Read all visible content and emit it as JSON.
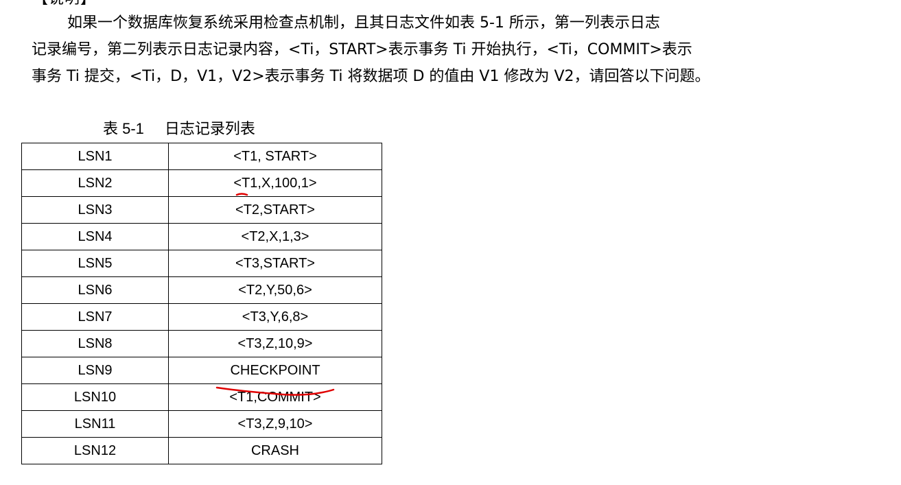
{
  "section_heading": "【说明】",
  "paragraph_lines": [
    "如果一个数据库恢复系统采用检查点机制，且其日志文件如表 5-1 所示，第一列表示日志",
    "记录编号，第二列表示日志记录内容，<Ti，START>表示事务 Ti 开始执行，<Ti，COMMIT>表示",
    "事务 Ti 提交，<Ti，D，V1，V2>表示事务 Ti 将数据项 D 的值由 V1 修改为 V2，请回答以下问题。"
  ],
  "table_caption": {
    "number": "表 5-1",
    "title": "日志记录列表"
  },
  "log_rows": [
    {
      "lsn": "LSN1",
      "record": "<T1, START>"
    },
    {
      "lsn": "LSN2",
      "record": "<T1,X,100,1>"
    },
    {
      "lsn": "LSN3",
      "record": "<T2,START>"
    },
    {
      "lsn": "LSN4",
      "record": "<T2,X,1,3>"
    },
    {
      "lsn": "LSN5",
      "record": "<T3,START>"
    },
    {
      "lsn": "LSN6",
      "record": "<T2,Y,50,6>"
    },
    {
      "lsn": "LSN7",
      "record": "<T3,Y,6,8>"
    },
    {
      "lsn": "LSN8",
      "record": "<T3,Z,10,9>"
    },
    {
      "lsn": "LSN9",
      "record": "CHECKPOINT"
    },
    {
      "lsn": "LSN10",
      "record": "<T1,COMMIT>"
    },
    {
      "lsn": "LSN11",
      "record": "<T3,Z,9,10>"
    },
    {
      "lsn": "LSN12",
      "record": "CRASH"
    }
  ],
  "colors": {
    "text": "#000000",
    "border": "#000000",
    "annotation": "#e00000"
  }
}
